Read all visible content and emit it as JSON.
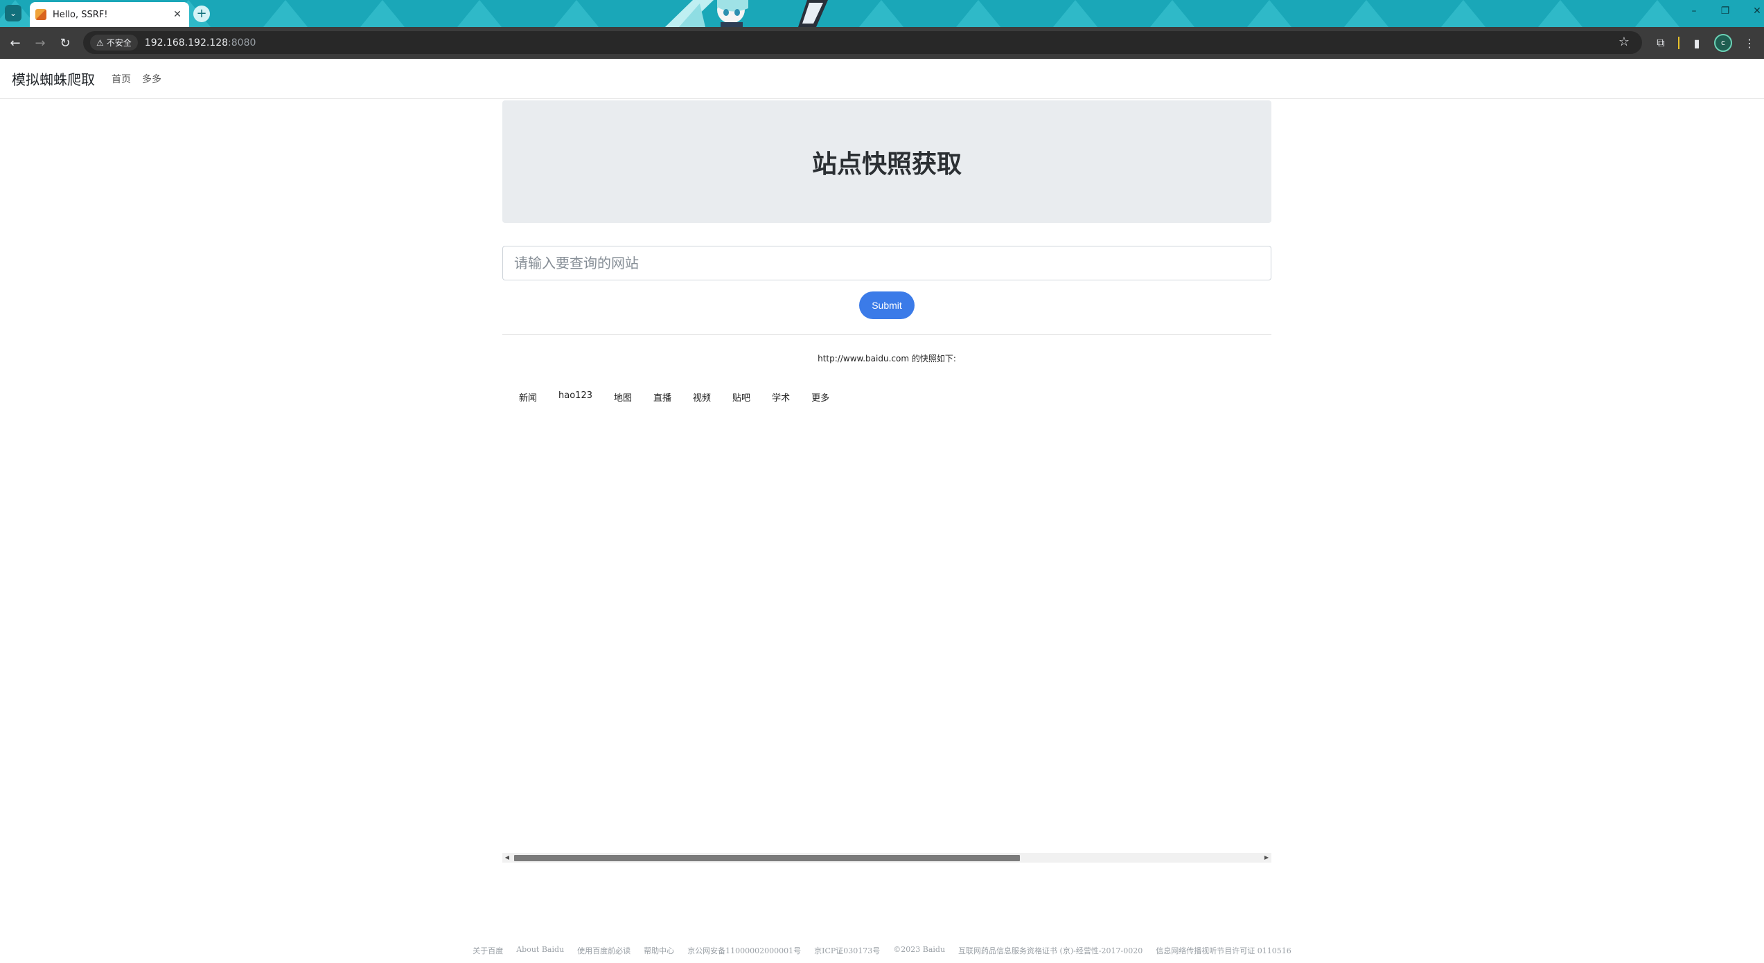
{
  "browser": {
    "tab_title": "Hello, SSRF!",
    "security_label": "不安全",
    "url_host": "192.168.192.128",
    "url_port": ":8080",
    "icons": [
      "tab-search-icon",
      "close-icon",
      "new-tab-icon",
      "back-icon",
      "forward-icon",
      "reload-icon",
      "warning-icon",
      "star-icon",
      "extensions-icon",
      "sidepanel-icon",
      "menu-icon",
      "minimize-icon",
      "restore-icon",
      "window-close-icon"
    ],
    "profile_initial": "c",
    "accent_color": "#1aa7b8"
  },
  "navbar": {
    "brand": "模拟蜘蛛爬取",
    "links": [
      "首页",
      "多多"
    ]
  },
  "main": {
    "heading": "站点快照获取",
    "input_placeholder": "请输入要查询的网站",
    "submit_label": "Submit",
    "result_caption": "http://www.baidu.com 的快照如下:"
  },
  "snapshot": {
    "nav_items": [
      "新闻",
      "hao123",
      "地图",
      "直播",
      "视频",
      "贴吧",
      "学术",
      "更多"
    ],
    "scroll_thumb_fraction": 0.87,
    "footer_links": [
      "关于百度",
      "About Baidu",
      "使用百度前必读",
      "帮助中心",
      "京公网安备11000002000001号",
      "京ICP证030173号",
      "©2023 Baidu",
      "互联网药品信息服务资格证书 (京)-经营性-2017-0020",
      "信息网络传播视听节目许可证 0110516"
    ]
  }
}
